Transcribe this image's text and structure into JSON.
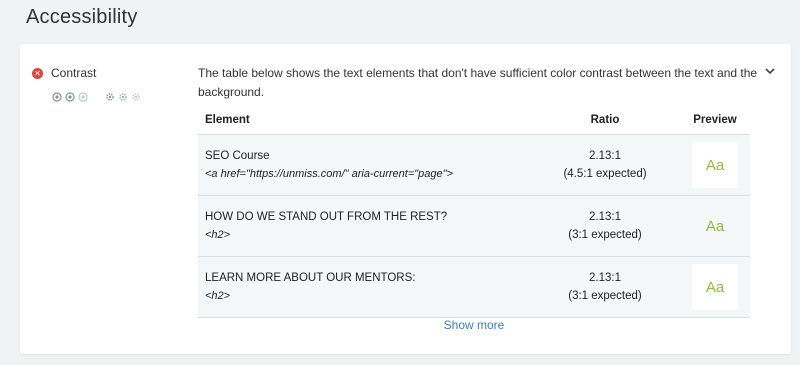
{
  "page": {
    "title": "Accessibility"
  },
  "check": {
    "name": "Contrast",
    "description": "The table below shows the text elements that don't have sufficient color contrast between the text and the background."
  },
  "table": {
    "headers": {
      "element": "Element",
      "ratio": "Ratio",
      "preview": "Preview"
    },
    "rows": [
      {
        "text": "SEO Course",
        "code": "<a href=\"https://unmiss.com/\" aria-current=\"page\">",
        "ratio": "2.13:1",
        "expected": "(4.5:1 expected)",
        "preview": "Aa"
      },
      {
        "text": "HOW DO WE STAND OUT FROM THE REST?",
        "code": "<h2>",
        "ratio": "2.13:1",
        "expected": "(3:1 expected)",
        "preview": "Aa"
      },
      {
        "text": "LEARN MORE ABOUT OUR MENTORS:",
        "code": "<h2>",
        "ratio": "2.13:1",
        "expected": "(3:1 expected)",
        "preview": "Aa"
      }
    ]
  },
  "show_more": "Show more",
  "colors": {
    "fail": "#e0443f",
    "link": "#3a7ec2",
    "preview_text": "#8bbf3a"
  }
}
